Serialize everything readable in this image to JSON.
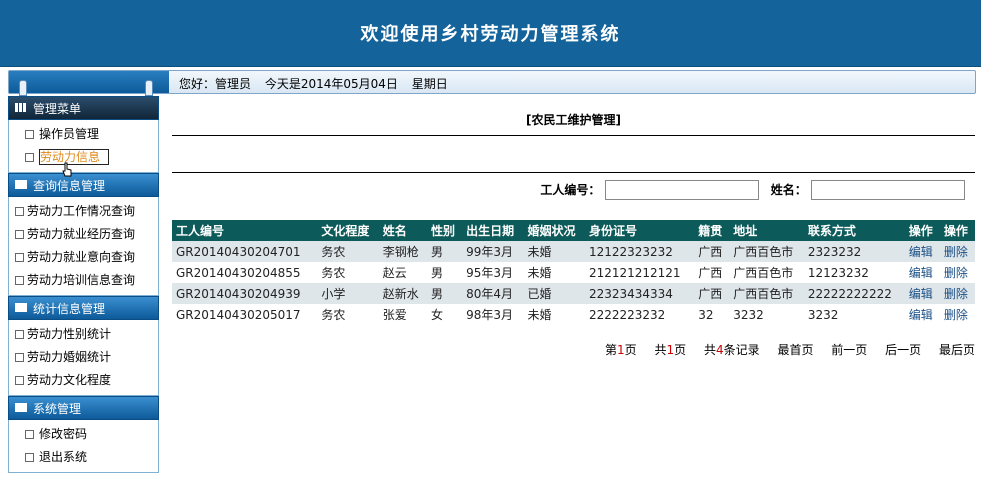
{
  "header": {
    "title": "欢迎使用乡村劳动力管理系统"
  },
  "infobar": {
    "greeting": "您好：管理员",
    "date": "今天是2014年05月04日",
    "weekday": "星期日"
  },
  "sidebar": {
    "groups": [
      {
        "title": "管理菜单",
        "items": [
          "操作员管理",
          "劳动力信息"
        ]
      },
      {
        "title": "查询信息管理",
        "items": [
          "劳动力工作情况查询",
          "劳动力就业经历查询",
          "劳动力就业意向查询",
          "劳动力培训信息查询"
        ]
      },
      {
        "title": "统计信息管理",
        "items": [
          "劳动力性别统计",
          "劳动力婚姻统计",
          "劳动力文化程度"
        ]
      },
      {
        "title": "系统管理",
        "items": [
          "修改密码",
          "退出系统"
        ]
      }
    ]
  },
  "main": {
    "title": "[农民工维护管理]",
    "search": {
      "worker_id_label": "工人编号：",
      "name_label": "姓名：",
      "worker_id_value": "",
      "name_value": ""
    },
    "table": {
      "headers": [
        "工人编号",
        "文化程度",
        "姓名",
        "性别",
        "出生日期",
        "婚姻状况",
        "身份证号",
        "籍贯",
        "地址",
        "联系方式",
        "操作",
        "操作"
      ],
      "rows": [
        [
          "GR20140430204701",
          "务农",
          "李钢枪",
          "男",
          "99年3月",
          "未婚",
          "12122323232",
          "广西",
          "广西百色市",
          "2323232",
          "编辑",
          "删除"
        ],
        [
          "GR20140430204855",
          "务农",
          "赵云",
          "男",
          "95年3月",
          "未婚",
          "212121212121",
          "广西",
          "广西百色市",
          "12123232",
          "编辑",
          "删除"
        ],
        [
          "GR20140430204939",
          "小学",
          "赵新水",
          "男",
          "80年4月",
          "已婚",
          "22323434334",
          "广西",
          "广西百色市",
          "22222222222",
          "编辑",
          "删除"
        ],
        [
          "GR20140430205017",
          "务农",
          "张爱",
          "女",
          "98年3月",
          "未婚",
          "2222223232",
          "32",
          "3232",
          "3232",
          "编辑",
          "删除"
        ]
      ]
    },
    "pager": {
      "page_prefix": "第",
      "page_num": "1",
      "page_suffix": "页",
      "total_prefix": "共",
      "total_pages": "1",
      "total_suffix": "页",
      "records_prefix": "共",
      "records": "4",
      "records_suffix": "条记录",
      "first": "最首页",
      "prev": "前一页",
      "next": "后一页",
      "last": "最后页"
    }
  }
}
